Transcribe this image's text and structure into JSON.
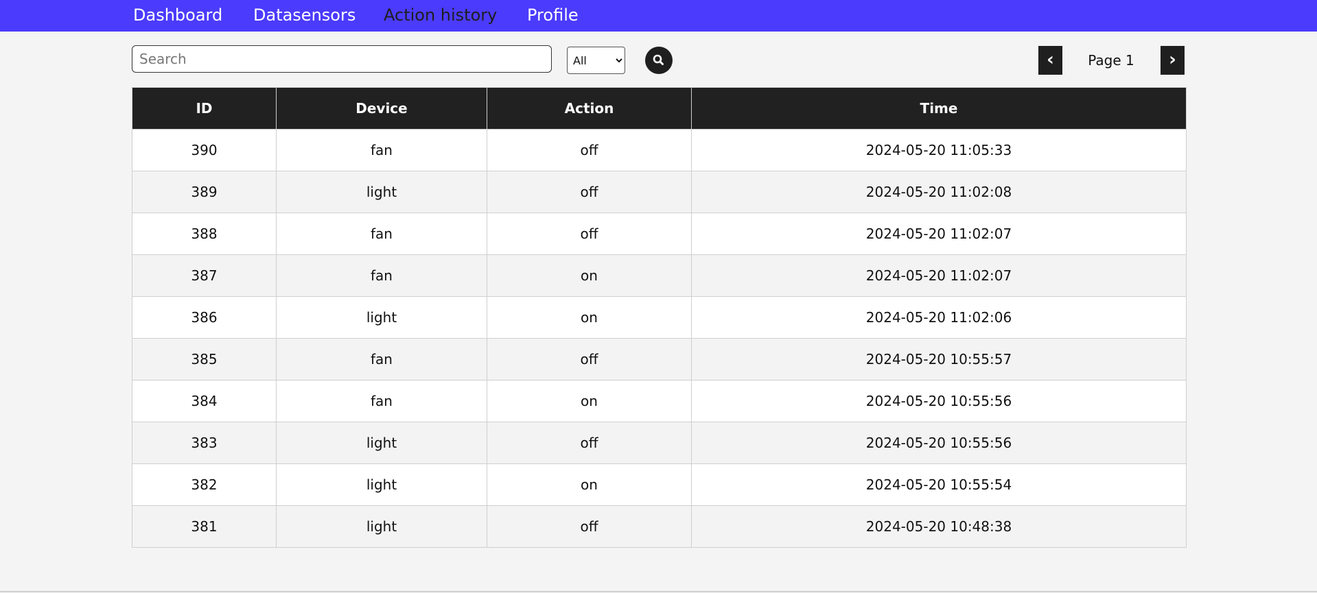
{
  "nav": {
    "items": [
      {
        "label": "Dashboard",
        "active": false
      },
      {
        "label": "Datasensors",
        "active": false
      },
      {
        "label": "Action history",
        "active": true
      },
      {
        "label": "Profile",
        "active": false
      }
    ],
    "background": "#4b3bfc"
  },
  "toolbar": {
    "search_placeholder": "Search",
    "search_value": "",
    "filter_selected": "All",
    "search_button_icon": "search-icon"
  },
  "pagination": {
    "prev_label": "‹",
    "next_label": "›",
    "page_label": "Page 1"
  },
  "table": {
    "columns": [
      "ID",
      "Device",
      "Action",
      "Time"
    ],
    "rows": [
      {
        "id": "390",
        "device": "fan",
        "action": "off",
        "time": "2024-05-20 11:05:33"
      },
      {
        "id": "389",
        "device": "light",
        "action": "off",
        "time": "2024-05-20 11:02:08"
      },
      {
        "id": "388",
        "device": "fan",
        "action": "off",
        "time": "2024-05-20 11:02:07"
      },
      {
        "id": "387",
        "device": "fan",
        "action": "on",
        "time": "2024-05-20 11:02:07"
      },
      {
        "id": "386",
        "device": "light",
        "action": "on",
        "time": "2024-05-20 11:02:06"
      },
      {
        "id": "385",
        "device": "fan",
        "action": "off",
        "time": "2024-05-20 10:55:57"
      },
      {
        "id": "384",
        "device": "fan",
        "action": "on",
        "time": "2024-05-20 10:55:56"
      },
      {
        "id": "383",
        "device": "light",
        "action": "off",
        "time": "2024-05-20 10:55:56"
      },
      {
        "id": "382",
        "device": "light",
        "action": "on",
        "time": "2024-05-20 10:55:54"
      },
      {
        "id": "381",
        "device": "light",
        "action": "off",
        "time": "2024-05-20 10:48:38"
      }
    ],
    "header_color": "#212121"
  }
}
